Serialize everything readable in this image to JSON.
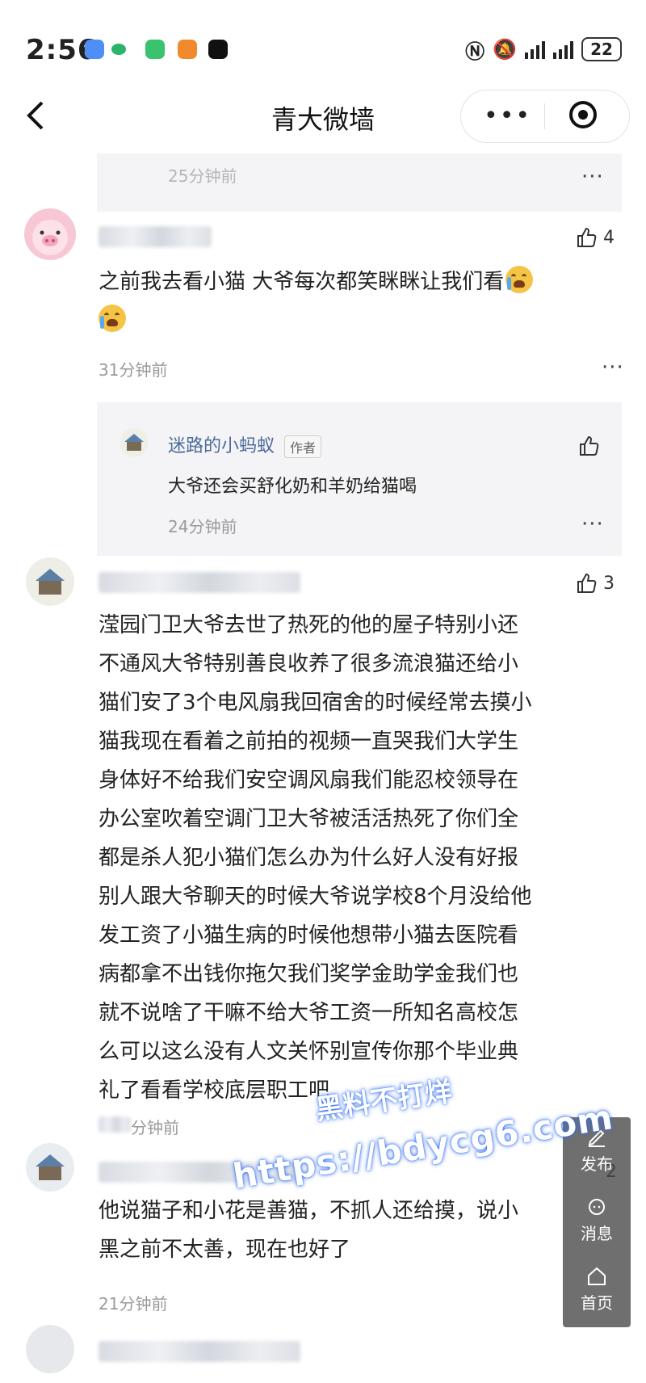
{
  "status_bar": {
    "time": "2:56",
    "battery": "22"
  },
  "header": {
    "title": "青大微墙",
    "more_label": "•••"
  },
  "comments": [
    {
      "time": "25分钟前"
    },
    {
      "text_line1": "之前我去看小猫 大爷每次都笑眯眯让我们看",
      "likes": "4",
      "time": "31分钟前"
    },
    {
      "text_lines": [
        "滢园门卫大爷去世了热死的他的屋子特别小还",
        "不通风大爷特别善良收养了很多流浪猫还给小",
        "猫们安了3个电风扇我回宿舍的时候经常去摸小",
        "猫我现在看着之前拍的视频一直哭我们大学生",
        "身体好不给我们安空调风扇我们能忍校领导在",
        "办公室吹着空调门卫大爷被活活热死了你们全",
        "都是杀人犯小猫们怎么办为什么好人没有好报",
        "别人跟大爷聊天的时候大爷说学校8个月没给他",
        "发工资了小猫生病的时候他想带小猫去医院看",
        "病都拿不出钱你拖欠我们奖学金助学金我们也",
        "就不说啥了干嘛不给大爷工资一所知名高校怎",
        "么可以这么没有人文关怀别宣传你那个毕业典",
        "礼了看看学校底层职工吧"
      ],
      "likes": "3",
      "time": "分钟前"
    },
    {
      "text_lines": [
        "他说猫子和小花是善猫，不抓人还给摸，说小",
        "黑之前不太善，现在也好了"
      ],
      "likes": "2",
      "time": "21分钟前"
    }
  ],
  "reply": {
    "username": "迷路的小蚂蚁",
    "tag": "作者",
    "text": "大爷还会买舒化奶和羊奶给猫喝",
    "time": "24分钟前"
  },
  "float_menu": {
    "post": "发布",
    "messages": "消息",
    "home": "首页"
  },
  "watermark": {
    "line1": "黑料不打烊",
    "line2": "https://bdycg6.com"
  },
  "colors": {
    "gray_box": "#f4f4f6",
    "time_gray": "#9a9a9a",
    "watermark_glow": "#2f6df0"
  }
}
